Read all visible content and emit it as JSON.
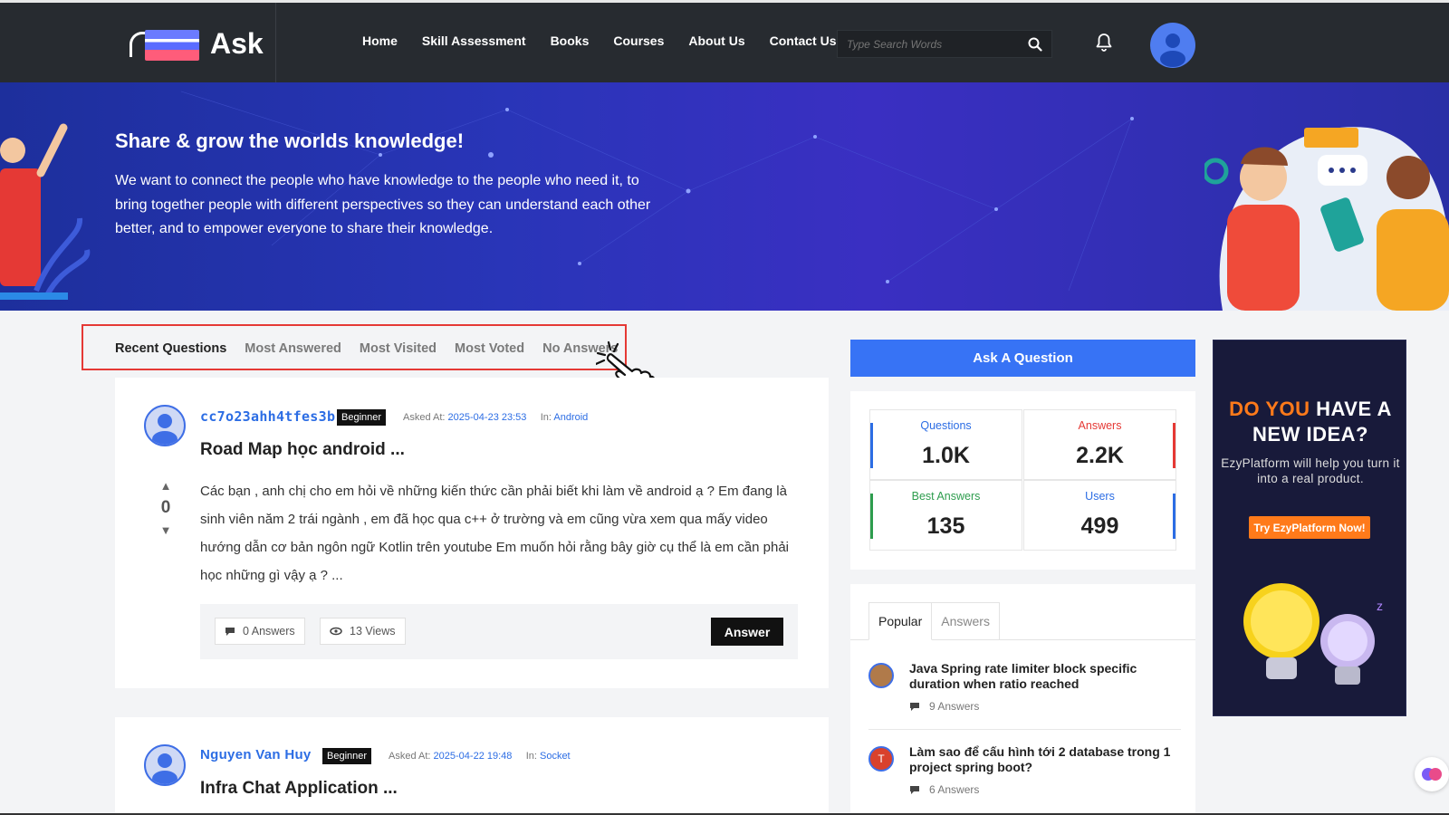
{
  "header": {
    "logo_text": "Ask",
    "nav": [
      "Home",
      "Skill Assessment",
      "Books",
      "Courses",
      "About Us",
      "Contact Us"
    ],
    "search_placeholder": "Type Search Words"
  },
  "hero": {
    "title": "Share & grow the worlds knowledge!",
    "text": "We want to connect the people who have knowledge to the people who need it, to bring together people with different perspectives so they can understand each other better, and to empower everyone to share their knowledge."
  },
  "tabs": [
    "Recent Questions",
    "Most Answered",
    "Most Visited",
    "Most Voted",
    "No Answers"
  ],
  "questions": [
    {
      "user": "cc7o23ahh4tfes3b",
      "badge": "Beginner",
      "asked_label": "Asked At:",
      "asked_at": "2025-04-23 23:53",
      "in_label": "In:",
      "category": "Android",
      "title": "Road Map học android ...",
      "votes": "0",
      "body": "Các bạn , anh chị cho em hỏi về những kiến thức cần phải biết khi làm về android ạ ? Em đang là sinh viên năm 2 trái ngành , em đã học qua c++ ở trường và em cũng vừa xem qua mấy video hướng dẫn cơ bản ngôn ngữ Kotlin trên youtube Em muốn hỏi rằng bây giờ cụ thể là em cần phải học những gì vậy ạ ? ...",
      "answers": "0 Answers",
      "views": "13 Views",
      "answer_button": "Answer"
    },
    {
      "user": "Nguyen Van Huy",
      "badge": "Beginner",
      "asked_label": "Asked At:",
      "asked_at": "2025-04-22 19:48",
      "in_label": "In:",
      "category": "Socket",
      "title": "Infra Chat Application ..."
    }
  ],
  "sidebar": {
    "ask_button": "Ask A Question",
    "stats": [
      {
        "label": "Questions",
        "value": "1.0K",
        "color": "#2c6de4"
      },
      {
        "label": "Answers",
        "value": "2.2K",
        "color": "#e53935"
      },
      {
        "label": "Best Answers",
        "value": "135",
        "color": "#2e9d4e"
      },
      {
        "label": "Users",
        "value": "499",
        "color": "#2c6de4"
      }
    ],
    "popular_tabs": [
      "Popular",
      "Answers"
    ],
    "popular": [
      {
        "title": "Java Spring rate limiter block specific duration when ratio reached",
        "answers": "9 Answers"
      },
      {
        "title": "Làm sao để cấu hình tới 2 database trong 1 project spring boot?",
        "answers": "6 Answers",
        "avatar_letter": "T"
      }
    ]
  },
  "ad": {
    "title_orange": "DO YOU",
    "title_white_1": "HAVE A",
    "title_white_2": "NEW IDEA?",
    "subtitle": "EzyPlatform will help you turn it into a real product.",
    "button": "Try EzyPlatform Now!"
  }
}
